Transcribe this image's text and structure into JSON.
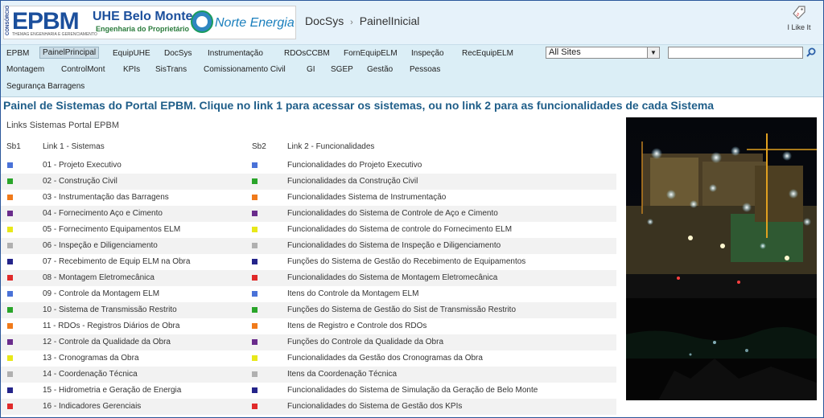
{
  "header": {
    "logo_epbm": "EPBM",
    "logo_epbm_consortium": "CONSÓRCIO",
    "logo_epbm_sub": "THEMAG ENGENHARIA E GERENCIAMENTO",
    "logo_uhe_title": "UHE Belo Monte",
    "logo_uhe_sub": "Engenharia do Proprietário",
    "logo_norte": "Norte Energia",
    "breadcrumb_site": "DocSys",
    "breadcrumb_sep": "›",
    "breadcrumb_page": "PainelInicial",
    "ilike_label": "I Like It"
  },
  "nav": {
    "items": [
      "EPBM",
      "PainelPrincipal",
      "EquipUHE",
      "DocSys",
      "Instrumentação",
      "RDOsCCBM",
      "FornEquipELM",
      "Inspeção",
      "RecEquipELM",
      "Montagem",
      "ControlMont",
      "KPIs",
      "SisTrans",
      "Comissionamento Civil",
      "GI",
      "SGEP",
      "Gestão",
      "Pessoas",
      "Segurança Barragens"
    ],
    "selected": "PainelPrincipal",
    "scope_value": "All Sites",
    "search_value": ""
  },
  "main": {
    "title": "Painel de Sistemas do Portal EPBM. Clique no link 1 para acessar os sistemas, ou no link 2 para as funcionalidades de cada Sistema",
    "list_title": "Links Sistemas Portal EPBM",
    "headers": {
      "sb1": "Sb1",
      "link1": "Link 1 - Sistemas",
      "sb2": "Sb2",
      "link2": "Link 2 - Funcionalidades"
    },
    "rows": [
      {
        "color": "#4a72d8",
        "link1": "01 - Projeto Executivo",
        "link2": "Funcionalidades do Projeto Executivo"
      },
      {
        "color": "#2aa52a",
        "link1": "02 - Construção Civil",
        "link2": "Funcionalidades da Construção Civil"
      },
      {
        "color": "#f07a1a",
        "link1": "03 - Instrumentação das Barragens",
        "link2": "Funcionalidades Sistema de Instrumentação"
      },
      {
        "color": "#6a2c8c",
        "link1": "04 - Fornecimento Aço e Cimento",
        "link2": "Funcionalidades do Sistema de Controle de Aço e Cimento"
      },
      {
        "color": "#e8e81a",
        "link1": "05 - Fornecimento Equipamentos ELM",
        "link2": "Funcionalidades do Sistema de controle do Fornecimento ELM"
      },
      {
        "color": "#b0b0b0",
        "link1": "06 - Inspeção e Diligenciamento",
        "link2": "Funcionalidades do Sistema de Inspeção e Diligenciamento"
      },
      {
        "color": "#24248a",
        "link1": "07 - Recebimento de Equip ELM na Obra",
        "link2": "Funções do Sistema de Gestão do Recebimento de Equipamentos"
      },
      {
        "color": "#e02a2a",
        "link1": "08 - Montagem Eletromecânica",
        "link2": "Funcionalidades do Sistema de Montagem Eletromecânica"
      },
      {
        "color": "#4a72d8",
        "link1": "09 - Controle da Montagem ELM",
        "link2": "Itens do Controle da Montagem ELM"
      },
      {
        "color": "#2aa52a",
        "link1": "10 - Sistema de Transmissão Restrito",
        "link2": "Funções do Sistema de Gestão do Sist de Transmissão Restrito"
      },
      {
        "color": "#f07a1a",
        "link1": "11 - RDOs - Registros Diários de Obra",
        "link2": "Itens de Registro e Controle dos RDOs"
      },
      {
        "color": "#6a2c8c",
        "link1": "12 - Controle da Qualidade da Obra",
        "link2": "Funções do Controle da Qualidade da Obra"
      },
      {
        "color": "#e8e81a",
        "link1": "13 - Cronogramas da Obra",
        "link2": "Funcionalidades da Gestão dos Cronogramas da Obra"
      },
      {
        "color": "#b0b0b0",
        "link1": "14 - Coordenação Técnica",
        "link2": "Itens da Coordenação Técnica"
      },
      {
        "color": "#24248a",
        "link1": "15 - Hidrometria e Geração de Energia",
        "link2": "Funcionalidades do Sistema de Simulação da Geração de Belo Monte"
      },
      {
        "color": "#e02a2a",
        "link1": "16 - Indicadores Gerenciais",
        "link2": "Funcionalidades do Sistema de Gestão dos KPIs"
      }
    ]
  }
}
